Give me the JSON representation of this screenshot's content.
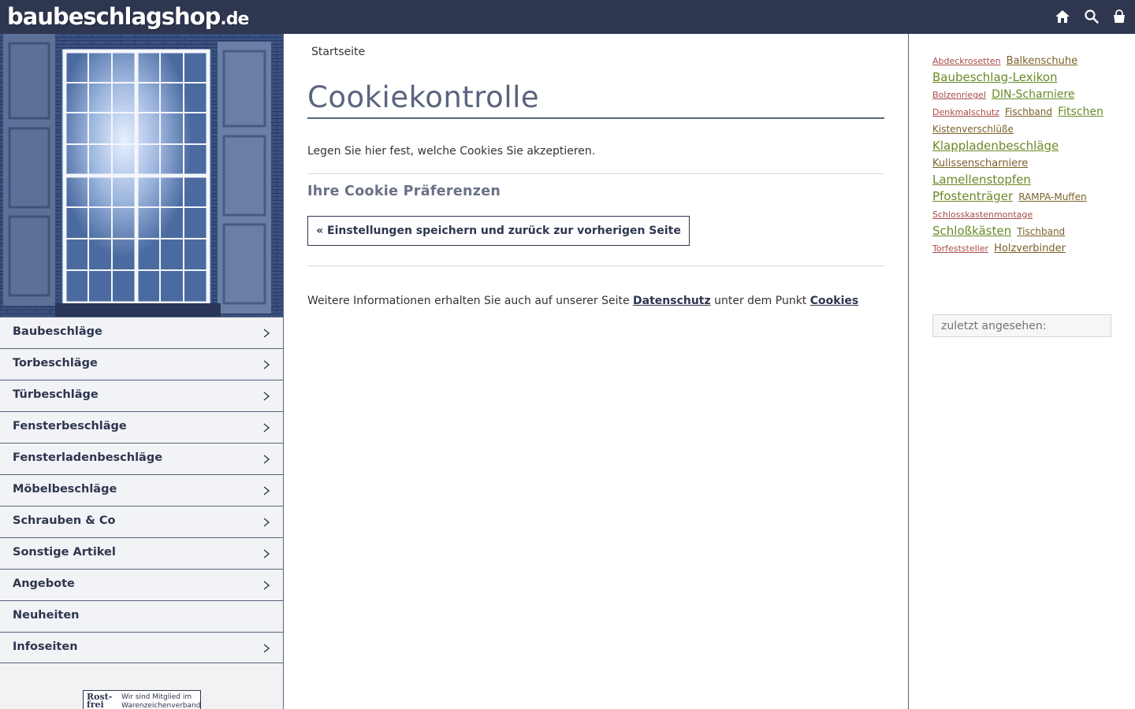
{
  "header": {
    "logo_main": "baubeschlagshop",
    "logo_tld": ".de",
    "icons": [
      "home-icon",
      "search-icon",
      "cart-icon"
    ],
    "bg_color": "#2e3650"
  },
  "sidebar": {
    "items": [
      {
        "label": "Baubeschläge",
        "has_children": true
      },
      {
        "label": "Torbeschläge",
        "has_children": true
      },
      {
        "label": "Türbeschläge",
        "has_children": true
      },
      {
        "label": "Fensterbeschläge",
        "has_children": true
      },
      {
        "label": "Fensterladenbeschläge",
        "has_children": true
      },
      {
        "label": "Möbelbeschläge",
        "has_children": true
      },
      {
        "label": "Schrauben & Co",
        "has_children": true
      },
      {
        "label": "Sonstige Artikel",
        "has_children": true
      },
      {
        "label": "Angebote",
        "has_children": true
      },
      {
        "label": "Neuheiten",
        "has_children": false
      },
      {
        "label": "Infoseiten",
        "has_children": true
      }
    ],
    "badge": {
      "logo_line1": "Rost-",
      "logo_line2": "frei",
      "text_line1": "Wir sind Mitglied im",
      "text_line2": "Warenzeichenverband"
    }
  },
  "main": {
    "breadcrumb": "Startseite",
    "title": "Cookiekontrolle",
    "intro": "Legen Sie hier fest, welche Cookies Sie akzeptieren.",
    "subtitle": "Ihre Cookie Präferenzen",
    "save_button": "« Einstellungen speichern und zurück zur vorherigen Seite",
    "more_info_prefix": "Weitere Informationen erhalten Sie auch auf unserer Seite ",
    "more_info_link1": "Datenschutz",
    "more_info_middle": " unter dem Punkt ",
    "more_info_link2": "Cookies"
  },
  "right": {
    "tags": [
      {
        "label": "Abdeckrosetten",
        "size": "s11",
        "color": "t-red"
      },
      {
        "label": "Balkenschuhe",
        "size": "s13",
        "color": "t-brown"
      },
      {
        "label": "Baubeschlag-Lexikon",
        "size": "s15",
        "color": "t-green"
      },
      {
        "label": "Bolzenriegel",
        "size": "s11",
        "color": "t-red"
      },
      {
        "label": "DIN-Scharniere",
        "size": "s14",
        "color": "t-green"
      },
      {
        "label": "Denkmalschutz",
        "size": "s11",
        "color": "t-red"
      },
      {
        "label": "Fischband",
        "size": "s12",
        "color": "t-brown"
      },
      {
        "label": "Fitschen",
        "size": "s14",
        "color": "t-green"
      },
      {
        "label": "Kistenverschlüße",
        "size": "s12",
        "color": "t-brown"
      },
      {
        "label": "Klappladenbeschläge",
        "size": "s15",
        "color": "t-green"
      },
      {
        "label": "Kulissenscharniere",
        "size": "s13",
        "color": "t-brown"
      },
      {
        "label": "Lamellenstopfen",
        "size": "s15",
        "color": "t-green"
      },
      {
        "label": "Pfostenträger",
        "size": "s15",
        "color": "t-green"
      },
      {
        "label": "RAMPA-Muffen",
        "size": "s12",
        "color": "t-brown"
      },
      {
        "label": "Schlosskastenmontage",
        "size": "s11",
        "color": "t-red"
      },
      {
        "label": "Schloßkästen",
        "size": "s15",
        "color": "t-green"
      },
      {
        "label": "Tischband",
        "size": "s12",
        "color": "t-brown"
      },
      {
        "label": "Torfeststeller",
        "size": "s11",
        "color": "t-red"
      },
      {
        "label": "Holzverbinder",
        "size": "s13",
        "color": "t-brown"
      }
    ],
    "recent_placeholder": "zuletzt angesehen:"
  }
}
